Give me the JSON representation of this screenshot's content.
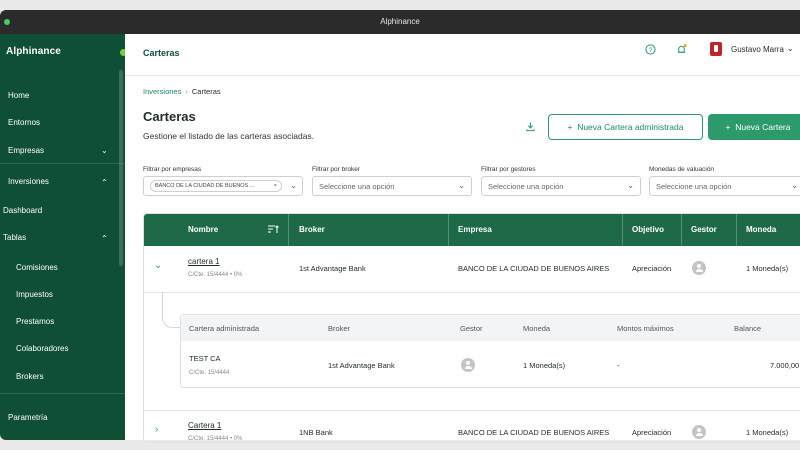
{
  "window": {
    "title": "Alphinance"
  },
  "sidebar": {
    "brand": "Alphinance",
    "items": [
      {
        "label": "Home"
      },
      {
        "label": "Entornos"
      },
      {
        "label": "Empresas"
      },
      {
        "label": "Inversiones"
      },
      {
        "label": "Dashboard"
      },
      {
        "label": "Tablas"
      },
      {
        "label": "Comisiones"
      },
      {
        "label": "Impuestos"
      },
      {
        "label": "Prestamos"
      },
      {
        "label": "Colaboradores"
      },
      {
        "label": "Brokers"
      },
      {
        "label": "Parametría"
      }
    ]
  },
  "topbar": {
    "title": "Carteras",
    "user_name": "Gustavo Marra"
  },
  "breadcrumb": {
    "parent": "Inversiones",
    "separator": "›",
    "current": "Carteras"
  },
  "page": {
    "title": "Carteras",
    "subtitle": "Gestione el listado de las carteras asociadas.",
    "btn_admin": "Nueva Cartera administrada",
    "btn_new": "Nueva Cartera"
  },
  "filters": {
    "empresas": {
      "label": "Filtrar por empresas",
      "chip": "BANCO DE LA CIUDAD DE BUENOS ..."
    },
    "broker": {
      "label": "Filtrar por broker",
      "placeholder": "Seleccione una opción"
    },
    "gestores": {
      "label": "Filtrar por gestores",
      "placeholder": "Seleccione una opción"
    },
    "monedas": {
      "label": "Monedas de valuación",
      "placeholder": "Seleccione una opción"
    }
  },
  "table": {
    "headers": [
      "Nombre",
      "Broker",
      "Empresa",
      "Objetivo",
      "Gestor",
      "Moneda"
    ],
    "rows": [
      {
        "name": "cartera 1",
        "meta": "C/Cte. 15/4444 • 0%",
        "broker": "1st Advantage Bank",
        "empresa": "BANCO DE LA CIUDAD DE BUENOS AIRES",
        "objetivo": "Apreciación",
        "moneda": "1 Moneda(s)"
      },
      {
        "name": "Cartera 1",
        "meta": "C/Cte. 15/4444 • 0%",
        "broker": "1NB Bank",
        "empresa": "BANCO DE LA CIUDAD DE BUENOS AIRES",
        "objetivo": "Apreciación",
        "moneda": "1 Moneda(s)"
      }
    ],
    "sub": {
      "headers": [
        "Cartera administrada",
        "Broker",
        "Gestor",
        "Moneda",
        "Montos máximos",
        "Balance"
      ],
      "row": {
        "name": "TEST CA",
        "meta": "C/Cte. 15/4444",
        "broker": "1st Advantage Bank",
        "moneda": "1 Moneda(s)",
        "montos": "-",
        "balance": "7.000,00"
      }
    }
  },
  "colors": {
    "sidebar": "#0e4f35",
    "header": "#1e6a48",
    "accent": "#2c9a6a"
  }
}
